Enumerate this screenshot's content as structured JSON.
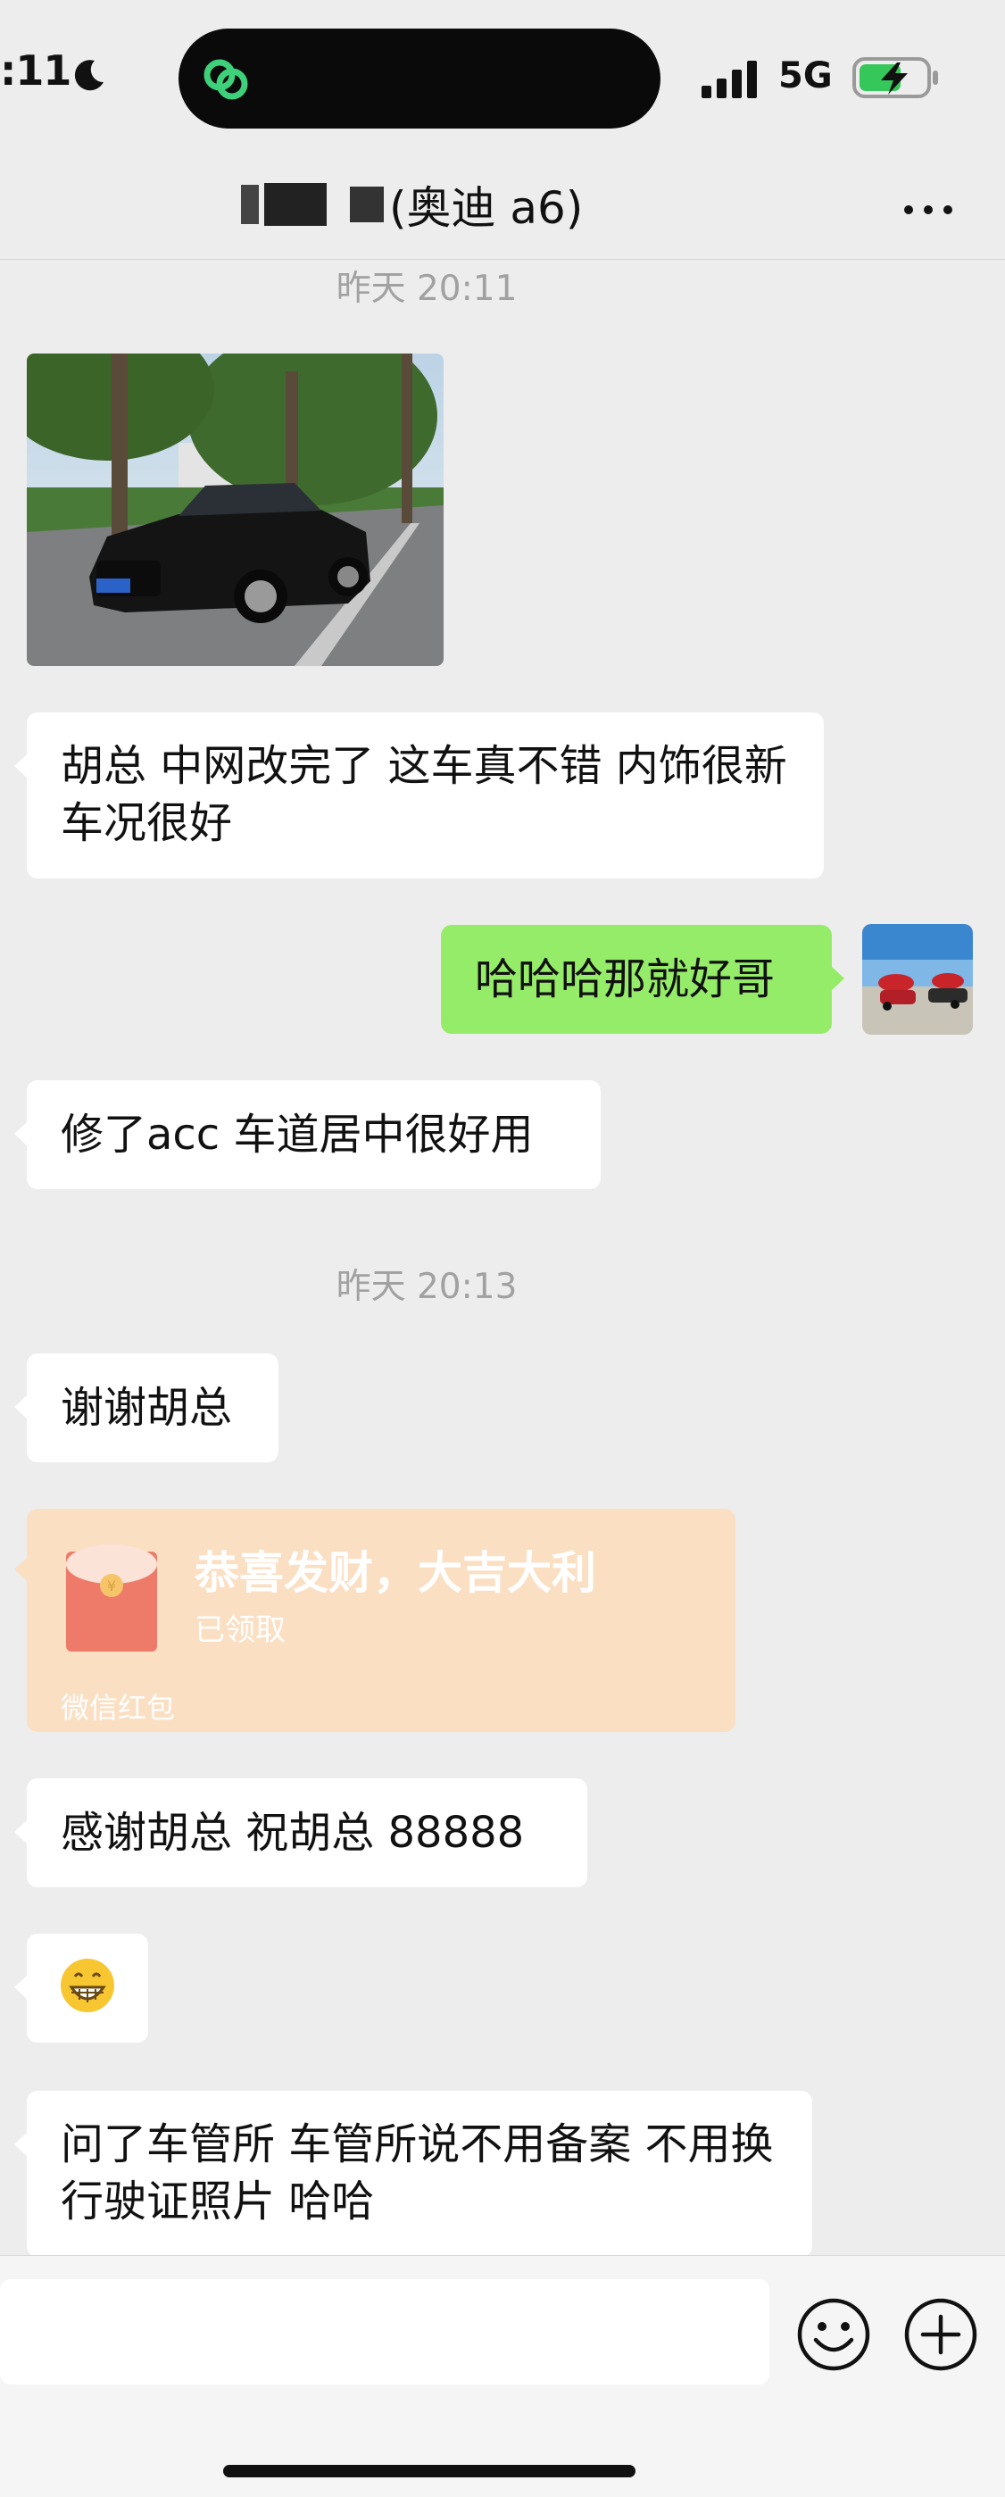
{
  "status_bar": {
    "time": ":11",
    "network": "5G"
  },
  "chat": {
    "title": "(奥迪 a6)"
  },
  "messages": {
    "ts1": "昨天 20:11",
    "m1": "胡总 中网改完了 这车真不错 内饰很新 车况很好",
    "m2": "哈哈哈那就好哥",
    "m3": "修了acc 车道居中很好用",
    "ts2": "昨天 20:13",
    "m4": "谢谢胡总",
    "red_packet": {
      "title": "恭喜发财，大吉大利",
      "status": "已领取",
      "footer": "微信红包"
    },
    "m5": "感谢胡总  祝胡总 88888",
    "m7": "问了车管所 车管所说不用备案 不用换行驶证照片 哈哈"
  },
  "colors": {
    "bg": "#ededed",
    "sent_bubble": "#95ec69",
    "recv_bubble": "#ffffff",
    "red_packet": "#fbdfc3"
  }
}
